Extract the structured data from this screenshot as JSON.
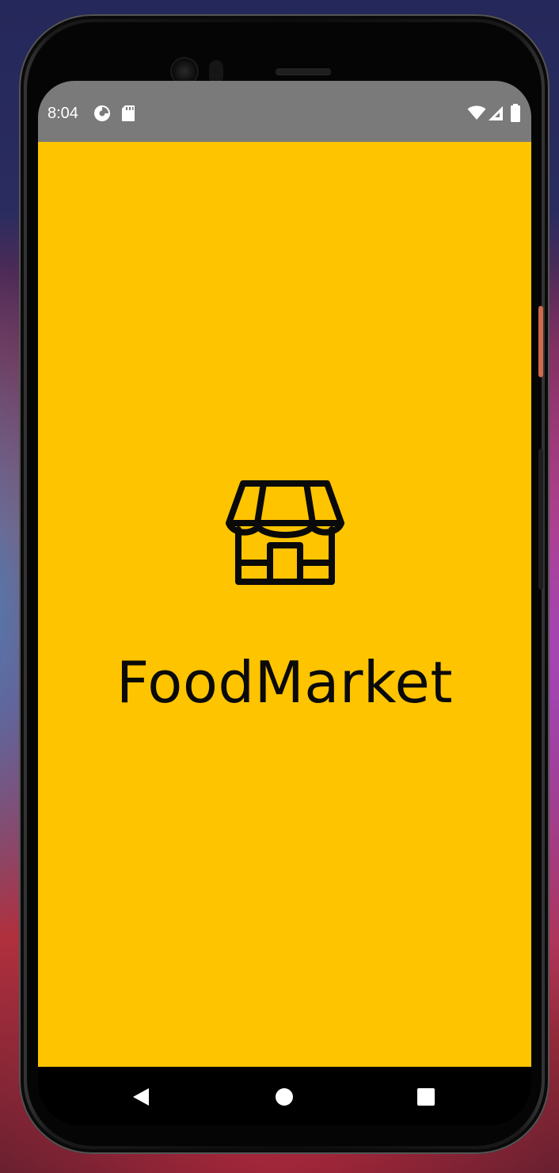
{
  "status_bar": {
    "time": "8:04",
    "left_icons": [
      "data-saver-icon",
      "sd-card-icon"
    ],
    "right_icons": [
      "wifi-icon",
      "cell-signal-icon",
      "battery-icon"
    ],
    "background_color": "#7a7a7a"
  },
  "app": {
    "name": "FoodMarket",
    "logo_icon": "storefront-icon",
    "background_color": "#ffc400",
    "text_color": "#0a0a0a"
  },
  "navigation_bar": {
    "buttons": [
      "back-icon",
      "home-icon",
      "recents-icon"
    ]
  }
}
